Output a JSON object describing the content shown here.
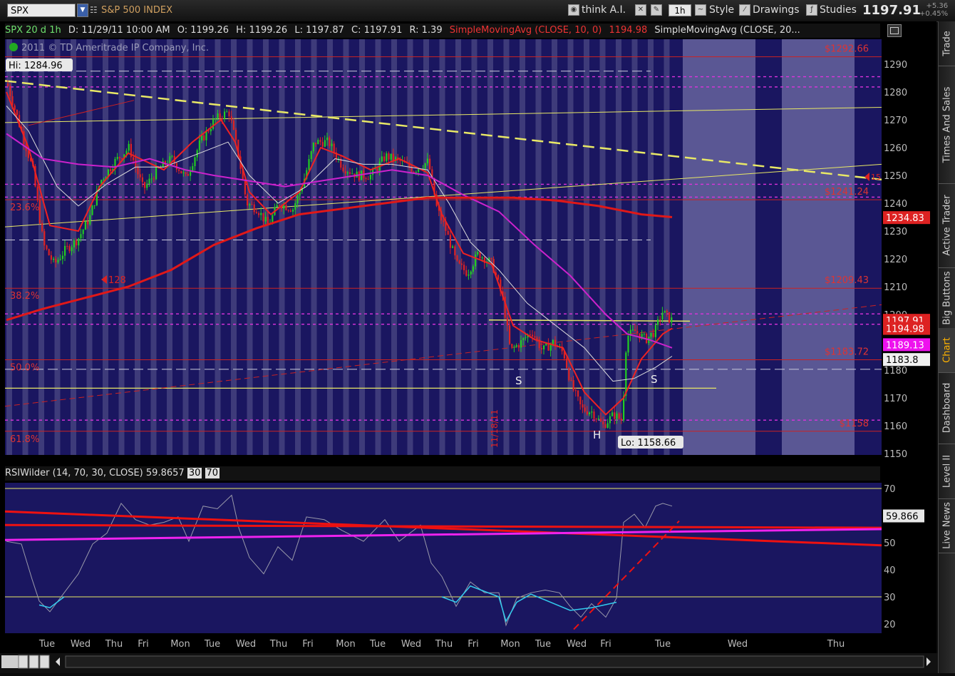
{
  "toolbar": {
    "symbol": "SPX",
    "symbol_name": "S&P 500 INDEX",
    "think_ai": "think A.I.",
    "timeframe": "1h",
    "style": "Style",
    "drawings": "Drawings",
    "studies": "Studies",
    "last_price": "1197.91",
    "change": "+5.36",
    "change_pct": "+0.45%"
  },
  "infobar": {
    "symbol": "SPX 20 d 1h",
    "date": "D: 11/29/11 10:00 AM",
    "open": "O: 1199.26",
    "high": "H: 1199.26",
    "low": "L: 1197.87",
    "close": "C: 1197.91",
    "range": "R: 1.39",
    "sma10": "SimpleMovingAvg (CLOSE, 10, 0)",
    "sma10_val": "1194.98",
    "sma20": "SimpleMovingAvg (CLOSE, 20..."
  },
  "watermark": "2011 © TD Ameritrade IP Company, Inc.",
  "hi_label": "Hi: 1284.96",
  "lo_label": "Lo: 1158.66",
  "fib_labels": [
    {
      "text": "23.6%",
      "price": 1241.24
    },
    {
      "text": "38.2%",
      "price": 1209.43
    },
    {
      "text": "50.0%",
      "price": 1183.72
    },
    {
      "text": "61.8%",
      "price": 1158.0
    }
  ],
  "fib_right_labels": [
    "$1292.66",
    "$1241.24",
    "$1209.43",
    "$1183.72",
    "$1158"
  ],
  "marker_128": "128",
  "vertical_date": "11/18/11",
  "pattern_labels": [
    "S",
    "H",
    "S"
  ],
  "right_edge_label": "15",
  "price_axis": [
    1290,
    1280,
    1270,
    1260,
    1250,
    1240,
    1230,
    1220,
    1210,
    1200,
    1190,
    1180,
    1170,
    1160,
    1150
  ],
  "price_tags": [
    {
      "text": "1234.83",
      "price": 1234.83,
      "color": "#dd2222"
    },
    {
      "text": "1197.91",
      "price": 1197.91,
      "color": "#dd2222"
    },
    {
      "text": "1194.98",
      "price": 1194.98,
      "color": "#dd2222"
    },
    {
      "text": "1189.13",
      "price": 1189.13,
      "color": "#ee11ee"
    },
    {
      "text": "1183.8",
      "price": 1183.8,
      "color": "#f0f0f0"
    }
  ],
  "day_labels": [
    "Tue",
    "Wed",
    "Thu",
    "Fri",
    "Mon",
    "Tue",
    "Wed",
    "Thu",
    "Fri",
    "Mon",
    "Tue",
    "Wed",
    "Thu",
    "Fri",
    "Mon",
    "Tue",
    "Wed",
    "Fri",
    "Tue",
    "Wed",
    "Thu"
  ],
  "rsi": {
    "study": "RSIWilder (14, 70, 30, CLOSE)",
    "value": "59.8657",
    "ob": "30",
    "os": "70",
    "tag": "59.866",
    "axis": [
      70,
      60,
      50,
      40,
      30,
      20
    ]
  },
  "side_tabs": [
    "Trade",
    "Times And Sales",
    "Active Trader",
    "Big Buttons",
    "Chart",
    "Dashboard",
    "Level II",
    "Live News"
  ],
  "colors": {
    "price_bg": "#1a1660",
    "stripe": "#3e3b7a",
    "future": "#5a5794",
    "up": "#22cc22",
    "down": "#dd2222",
    "sma_red": "#ee2222",
    "sma_magenta": "#cc22cc",
    "sma_white": "#dddddd",
    "yellow": "#e8e866"
  }
}
